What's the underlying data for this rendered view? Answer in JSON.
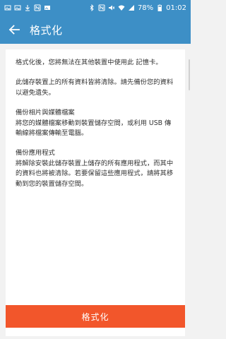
{
  "status_bar": {
    "battery": "78%",
    "time": "01:02",
    "left_icons": [
      "photo-icon",
      "photo-icon",
      "download-icon",
      "nfc-icon",
      "image-icon"
    ],
    "right_icons": [
      "bluetooth-icon",
      "nfc-icon",
      "mute-icon",
      "wifi-icon",
      "signal-icon",
      "battery-icon"
    ]
  },
  "app_bar": {
    "title": "格式化",
    "back_icon": "arrow-left-icon"
  },
  "content": {
    "intro": "格式化後，您將無法在其他裝置中使用此 記憶卡。",
    "warning": "此儲存裝置上的所有資料皆將清除。請先備份您的資料以避免遺失。",
    "section_media": {
      "heading": "備份相片與媒體檔案",
      "body": "將您的媒體檔案移動到裝置儲存空間，或利用 USB 傳輸線將檔案傳輸至電腦。"
    },
    "section_apps": {
      "heading": "備份應用程式",
      "body": "將解除安裝此儲存裝置上儲存的所有應用程式，而其中的資料也將被清除。若要保留這些應用程式，請將其移動到您的裝置儲存空間。"
    }
  },
  "footer": {
    "format_button_label": "格式化"
  },
  "colors": {
    "header": "#3d8fc6",
    "button": "#f2562b",
    "background": "#f2f2f2"
  }
}
